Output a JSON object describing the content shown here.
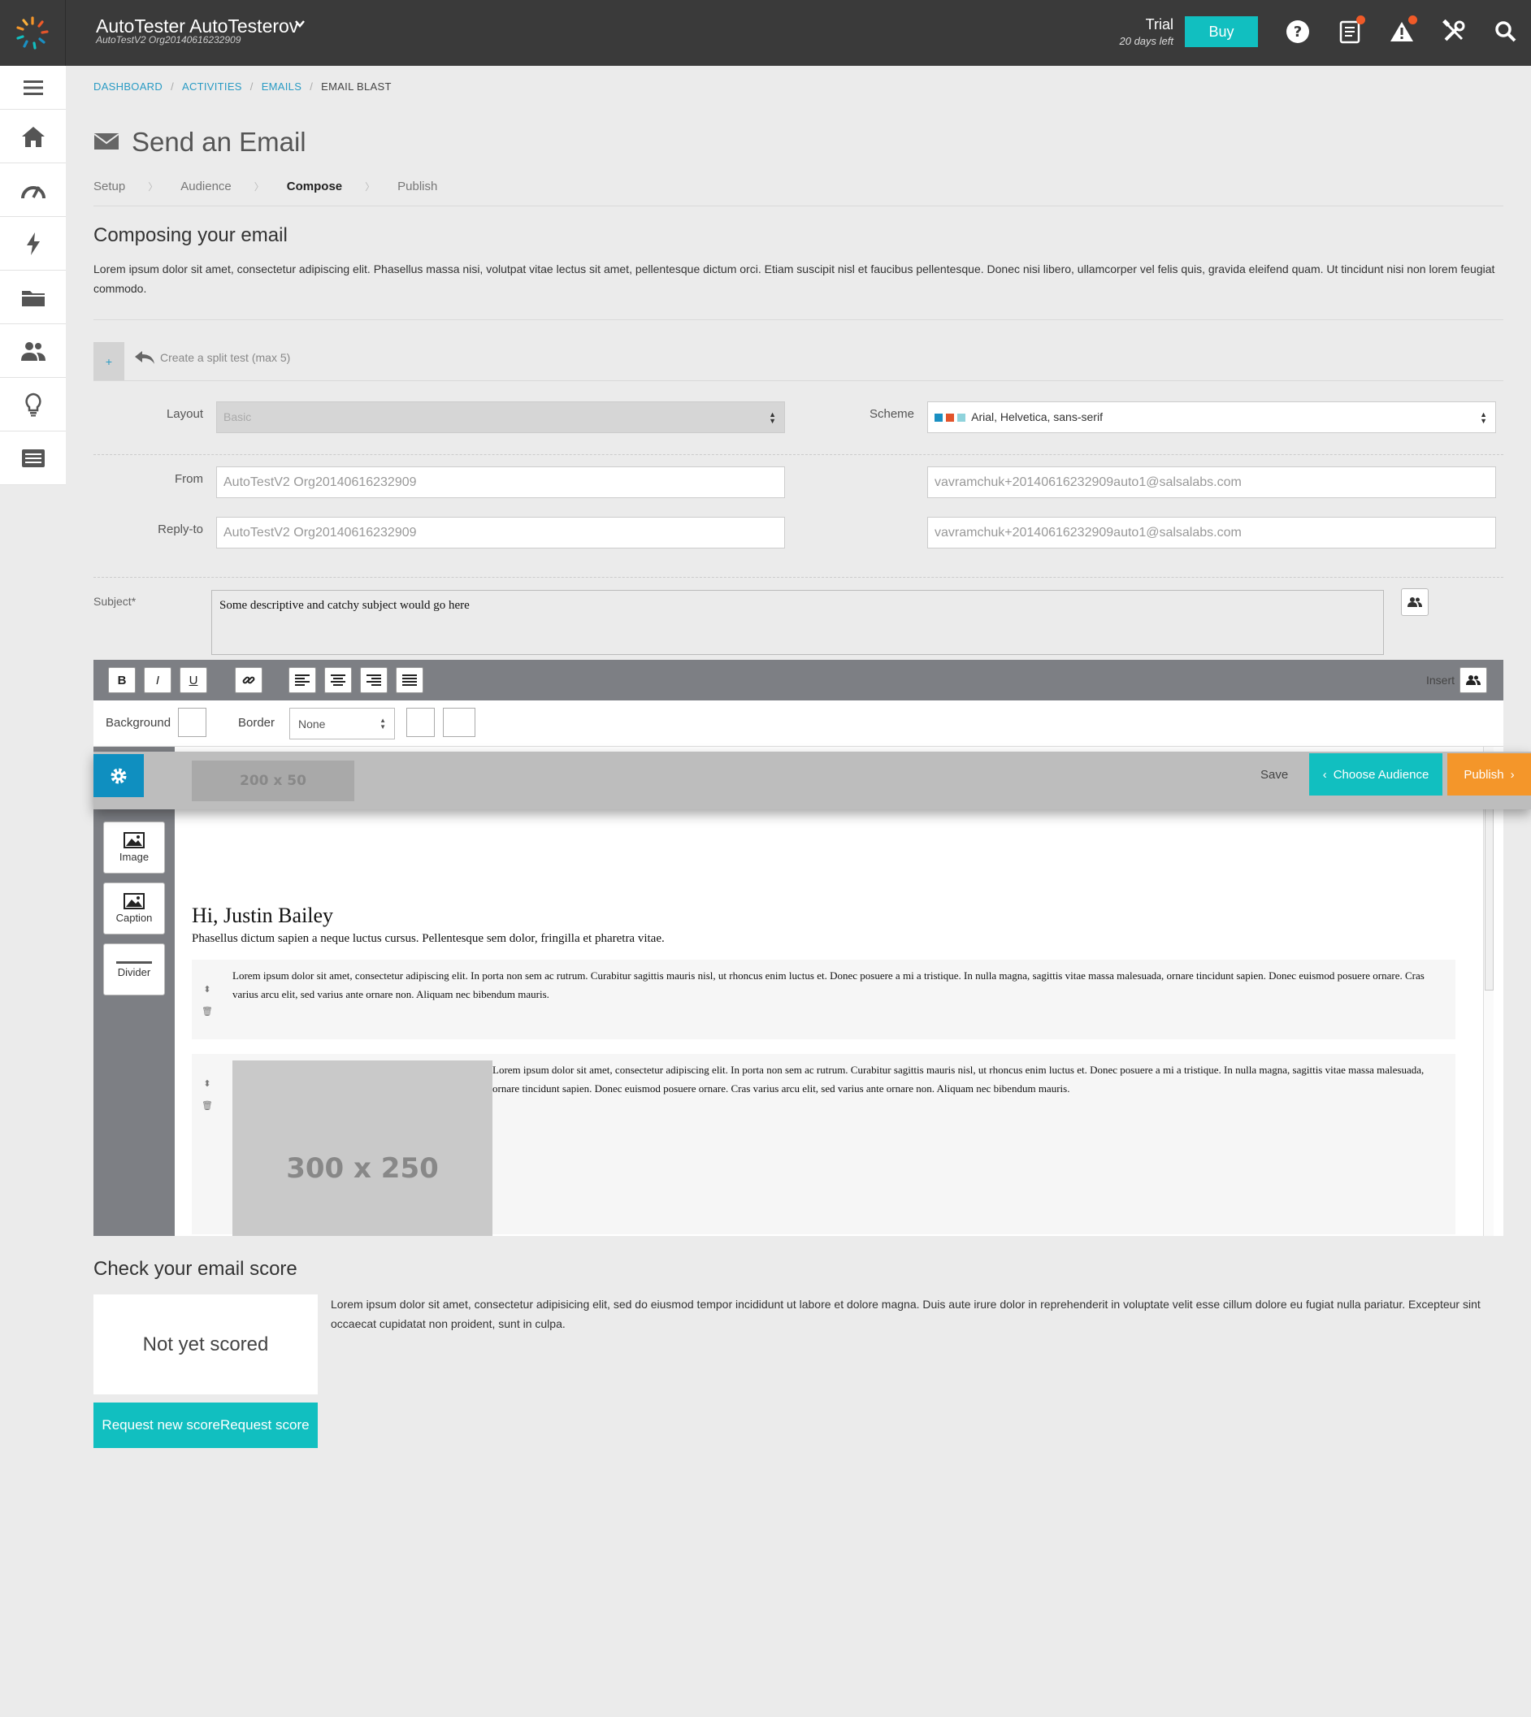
{
  "header": {
    "user_name": "AutoTester AutoTesterov",
    "org_name": "AutoTestV2 Org20140616232909",
    "trial_label": "Trial",
    "trial_days": "20 days left",
    "buy_label": "Buy",
    "brand_color": "#11bfc0",
    "icons": [
      "help-icon",
      "notes-icon",
      "alert-icon",
      "tools-icon",
      "search-icon"
    ]
  },
  "sidebar": {
    "items": [
      "menu-icon",
      "home-icon",
      "dashboard-icon",
      "activities-icon",
      "folder-icon",
      "people-icon",
      "ideas-icon",
      "list-icon"
    ]
  },
  "breadcrumb": [
    "DASHBOARD",
    "ACTIVITIES",
    "EMAILS",
    "EMAIL BLAST"
  ],
  "page_title": "Send an Email",
  "steps": [
    "Setup",
    "Audience",
    "Compose",
    "Publish"
  ],
  "active_step": "Compose",
  "compose": {
    "heading": "Composing your email",
    "description": "Lorem ipsum dolor sit amet, consectetur adipiscing elit. Phasellus massa nisi, volutpat vitae lectus sit amet, pellentesque dictum orci. Etiam suscipit nisl et faucibus pellentesque. Donec nisi libero, ullamcorper vel felis quis, gravida eleifend quam. Ut tincidunt nisi non lorem feugiat commodo.",
    "split_plus": "+",
    "split_link": "Create a split test (max 5)"
  },
  "form": {
    "layout_label": "Layout",
    "layout_value": "Basic",
    "scheme_label": "Scheme",
    "scheme_value": "Arial, Helvetica, sans-serif",
    "scheme_colors": [
      "#1a8fc2",
      "#e2542b",
      "#8fd3dc"
    ],
    "from_label": "From",
    "from_name": "AutoTestV2 Org20140616232909",
    "from_email": "vavramchuk+20140616232909auto1@salsalabs.com",
    "reply_label": "Reply-to",
    "reply_name": "AutoTestV2 Org20140616232909",
    "reply_email": "vavramchuk+20140616232909auto1@salsalabs.com",
    "subject_label": "Subject*",
    "subject_value": "Some descriptive and catchy subject would go here"
  },
  "editor": {
    "bold": "B",
    "italic": "I",
    "underline": "U",
    "insert_label": "Insert",
    "background_label": "Background",
    "border_label": "Border",
    "border_value": "None",
    "blocks": {
      "image": "Image",
      "caption": "Caption",
      "divider": "Divider"
    },
    "header_placeholder": "200 x 50",
    "save_label": "Save",
    "choose_audience_label": "Choose Audience",
    "publish_label": "Publish",
    "greeting": "Hi, Justin Bailey",
    "greeting_sub": "Phasellus dictum sapien a neque luctus cursus. Pellentesque sem dolor, fringilla et pharetra vitae.",
    "block1_text": "Lorem ipsum dolor sit amet, consectetur adipiscing elit. In porta non sem ac rutrum. Curabitur sagittis mauris nisl, ut rhoncus enim luctus et. Donec posuere a mi a tristique. In nulla magna, sagittis vitae massa malesuada, ornare tincidunt sapien. Donec euismod posuere ornare. Cras varius arcu elit, sed varius ante ornare non. Aliquam nec bibendum mauris.",
    "block2_text": "Lorem ipsum dolor sit amet, consectetur adipiscing elit. In porta non sem ac rutrum. Curabitur sagittis mauris nisl, ut rhoncus enim luctus et. Donec posuere a mi a tristique. In nulla magna, sagittis vitae massa malesuada, ornare tincidunt sapien. Donec euismod posuere ornare. Cras varius arcu elit, sed varius ante ornare non. Aliquam nec bibendum mauris.",
    "image_placeholder": "300 x 250",
    "publish_color": "#f4962a"
  },
  "score": {
    "heading": "Check your email score",
    "status": "Not yet scored",
    "button_label": "Request new scoreRequest score",
    "description": "Lorem ipsum dolor sit amet, consectetur adipisicing elit, sed do eiusmod tempor incididunt ut labore et dolore magna. Duis aute irure dolor in reprehenderit in voluptate velit esse cillum dolore eu fugiat nulla pariatur. Excepteur sint occaecat cupidatat non proident, sunt in culpa."
  }
}
